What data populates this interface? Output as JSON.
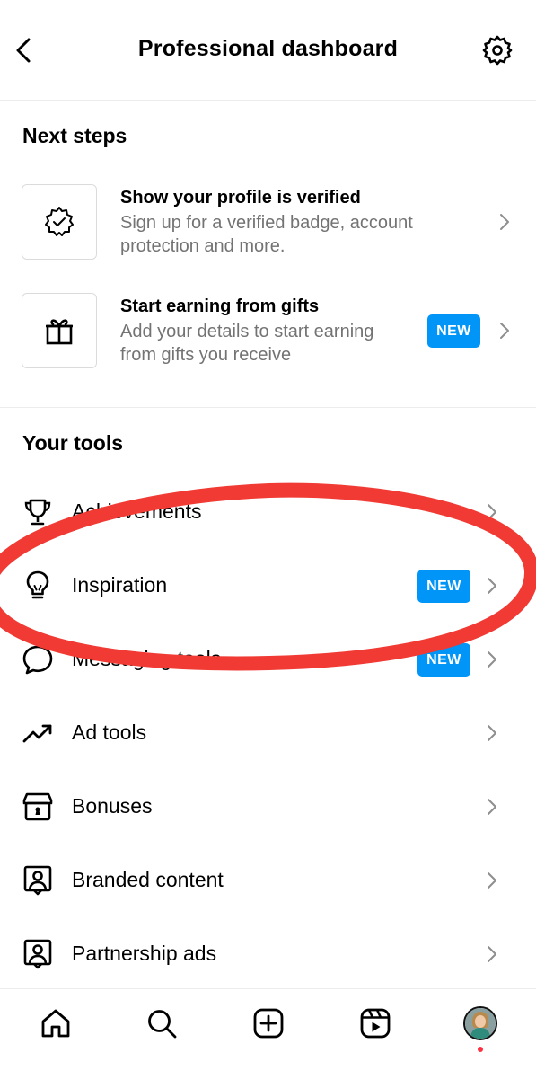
{
  "header": {
    "title": "Professional dashboard"
  },
  "next_steps": {
    "heading": "Next steps",
    "items": [
      {
        "title": "Show your profile is verified",
        "subtitle": "Sign up for a verified badge, account protection and more.",
        "icon": "verified-badge-icon",
        "badge": ""
      },
      {
        "title": "Start earning from gifts",
        "subtitle": "Add your details to start earning from gifts you receive",
        "icon": "gift-icon",
        "badge": "NEW"
      }
    ]
  },
  "your_tools": {
    "heading": "Your tools",
    "items": [
      {
        "label": "Achievements",
        "icon": "trophy-icon",
        "badge": ""
      },
      {
        "label": "Inspiration",
        "icon": "lightbulb-icon",
        "badge": "NEW"
      },
      {
        "label": "Messaging tools",
        "icon": "message-bubble-icon",
        "badge": "NEW"
      },
      {
        "label": "Ad tools",
        "icon": "trending-up-icon",
        "badge": ""
      },
      {
        "label": "Bonuses",
        "icon": "gift-box-icon",
        "badge": ""
      },
      {
        "label": "Branded content",
        "icon": "branded-content-icon",
        "badge": ""
      },
      {
        "label": "Partnership ads",
        "icon": "partnership-ads-icon",
        "badge": ""
      }
    ]
  },
  "bottom_nav": [
    {
      "name": "home",
      "icon": "home-icon"
    },
    {
      "name": "search",
      "icon": "search-icon"
    },
    {
      "name": "create",
      "icon": "plus-square-icon"
    },
    {
      "name": "reels",
      "icon": "reels-icon"
    },
    {
      "name": "profile",
      "icon": "avatar"
    }
  ],
  "colors": {
    "accent": "#0095f6",
    "annotation": "#f03a33",
    "notification_dot": "#ff3040",
    "secondary_text": "#737373"
  }
}
